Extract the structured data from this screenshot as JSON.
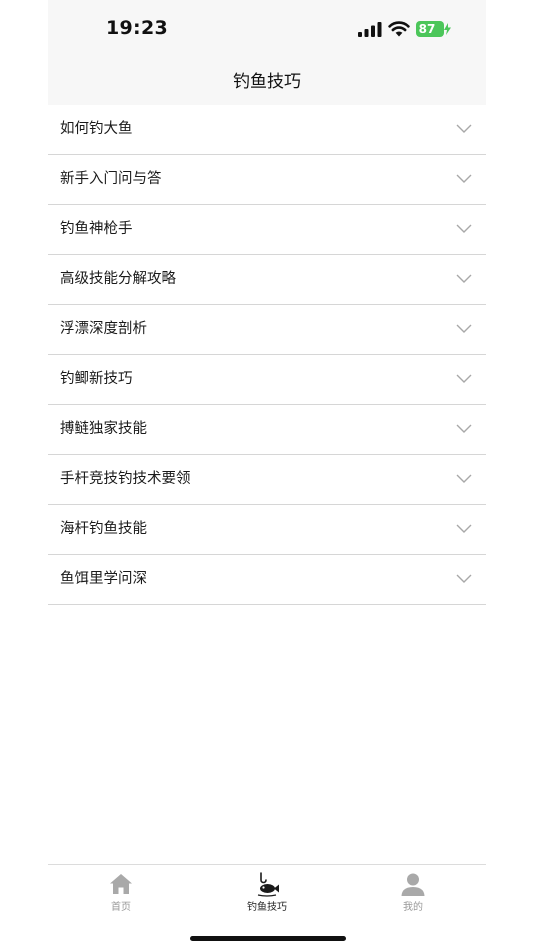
{
  "status_bar": {
    "time": "19:23",
    "battery": "87",
    "icons": [
      "cellular-signal-icon",
      "wifi-icon",
      "battery-icon"
    ]
  },
  "nav": {
    "title": "钓鱼技巧"
  },
  "list": {
    "items": [
      {
        "label": "如何钓大鱼"
      },
      {
        "label": "新手入门问与答"
      },
      {
        "label": "钓鱼神枪手"
      },
      {
        "label": "高级技能分解攻略"
      },
      {
        "label": "浮漂深度剖析"
      },
      {
        "label": "钓鲫新技巧"
      },
      {
        "label": "搏鲢独家技能"
      },
      {
        "label": "手杆竞技钓技术要领"
      },
      {
        "label": "海杆钓鱼技能"
      },
      {
        "label": "鱼饵里学问深"
      }
    ],
    "chevron_icon": "chevron-down-icon"
  },
  "tab_bar": {
    "tabs": [
      {
        "label": "首页",
        "icon": "home-icon",
        "active": false
      },
      {
        "label": "钓鱼技巧",
        "icon": "fish-hook-icon",
        "active": true
      },
      {
        "label": "我的",
        "icon": "user-icon",
        "active": false
      }
    ]
  },
  "colors": {
    "battery": "#4cc65a",
    "header_bg": "#f7f7f7",
    "divider": "#d6d6d6",
    "tab_inactive": "#999999",
    "tab_active": "#222222"
  }
}
